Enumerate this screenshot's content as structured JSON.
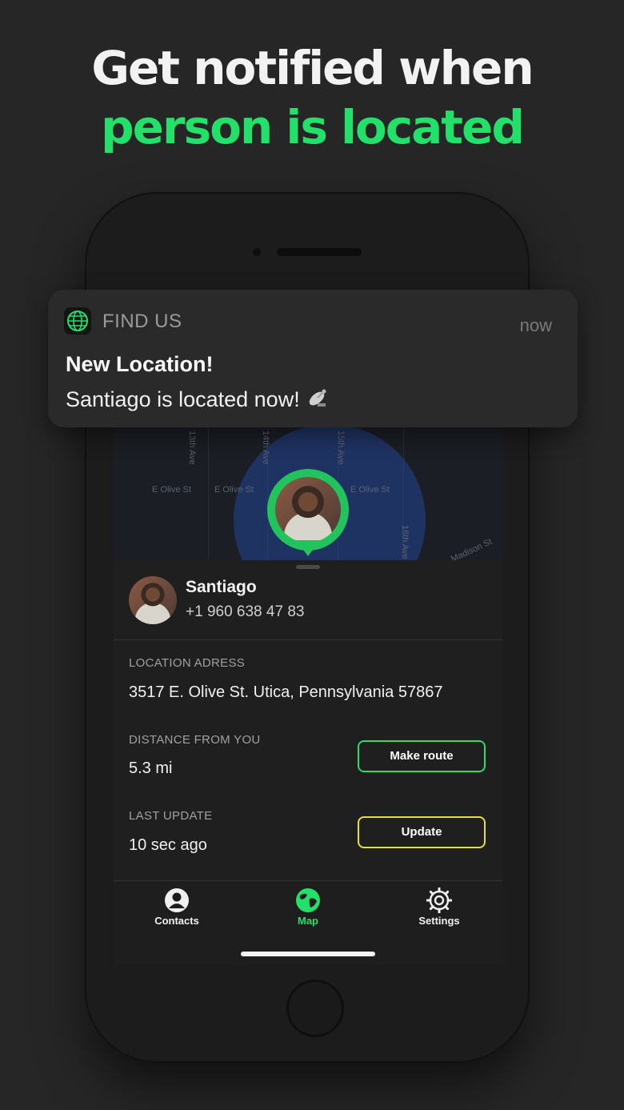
{
  "headline": {
    "line1": "Get notified when",
    "line2": "person is located"
  },
  "notification": {
    "app_name": "FIND US",
    "time": "now",
    "title": "New Location!",
    "body": "Santiago is located now!",
    "emoji_icon": "satellite-dish-icon"
  },
  "map": {
    "streets": [
      "13th Ave",
      "14th Ave",
      "15th Ave",
      "16th Ave",
      "E Olive St",
      "E Olive St",
      "E Olive St",
      "Madison St"
    ]
  },
  "contact": {
    "name": "Santiago",
    "phone": "+1 960 638 47 83"
  },
  "details": {
    "location_label": "LOCATION ADRESS",
    "location_value": "3517 E. Olive St. Utica, Pennsylvania 57867",
    "distance_label": "DISTANCE FROM YOU",
    "distance_value": "5.3 mi",
    "last_update_label": "LAST UPDATE",
    "last_update_value": "10 sec ago",
    "make_route_label": "Make route",
    "update_label": "Update"
  },
  "tabs": [
    {
      "label": "Contacts",
      "icon": "person-icon",
      "active": false
    },
    {
      "label": "Map",
      "icon": "globe-icon",
      "active": true
    },
    {
      "label": "Settings",
      "icon": "gear-icon",
      "active": false
    }
  ],
  "colors": {
    "accent_green": "#22e06a",
    "update_yellow": "#e6e035",
    "background": "#262626"
  }
}
